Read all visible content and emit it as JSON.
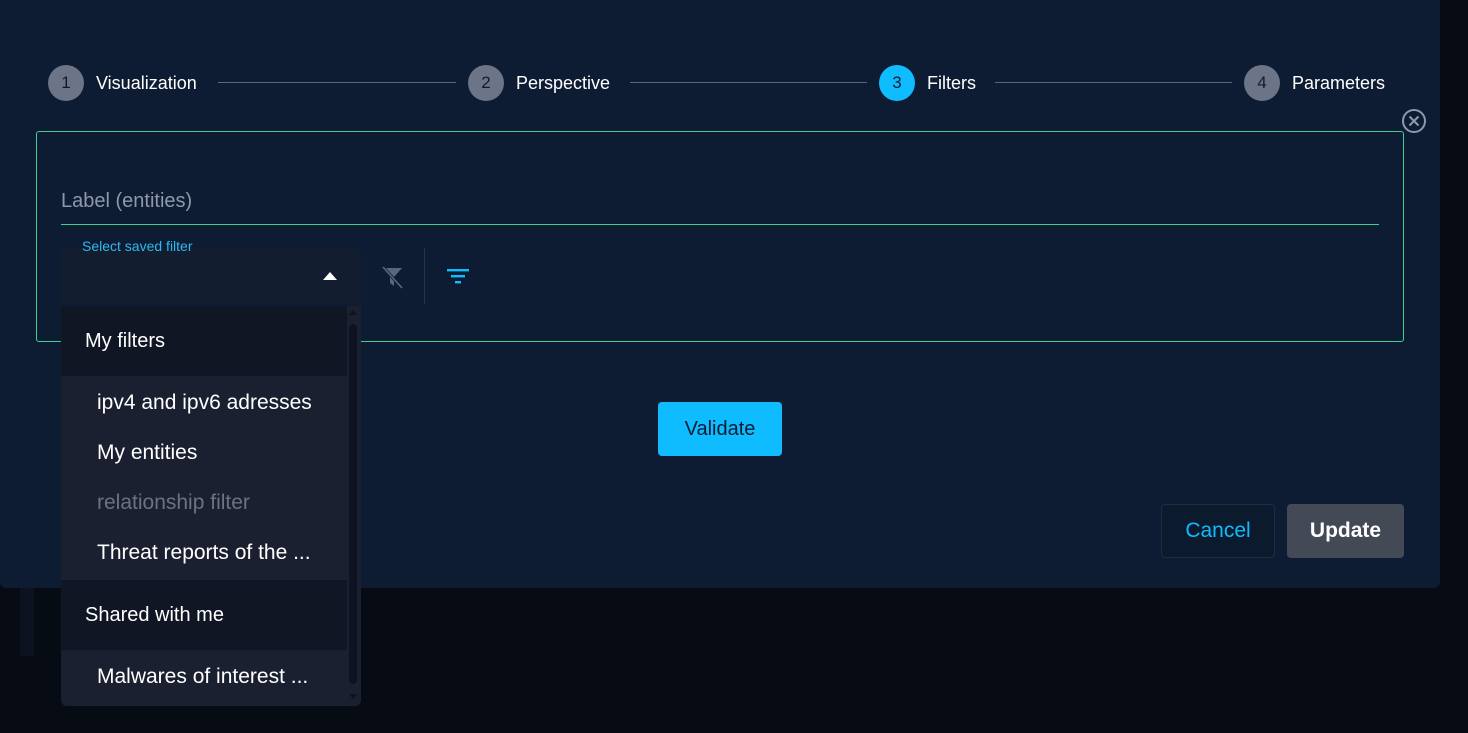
{
  "stepper": {
    "steps": [
      {
        "number": "1",
        "label": "Visualization",
        "active": false
      },
      {
        "number": "2",
        "label": "Perspective",
        "active": false
      },
      {
        "number": "3",
        "label": "Filters",
        "active": true
      },
      {
        "number": "4",
        "label": "Parameters",
        "active": false
      }
    ]
  },
  "filters": {
    "label_placeholder": "Label (entities)",
    "saved_filter_caption": "Select saved filter",
    "saved_filter_value": ""
  },
  "dropdown": {
    "groups": [
      {
        "header": "My filters",
        "options": [
          {
            "label": "ipv4 and ipv6 adresses",
            "disabled": false
          },
          {
            "label": "My entities",
            "disabled": false
          },
          {
            "label": "relationship filter",
            "disabled": true
          },
          {
            "label": "Threat reports of the ...",
            "disabled": false
          }
        ]
      },
      {
        "header": "Shared with me",
        "options": [
          {
            "label": "Malwares of interest ...",
            "disabled": false
          }
        ]
      }
    ]
  },
  "buttons": {
    "validate": "Validate",
    "cancel": "Cancel",
    "update": "Update"
  },
  "icons": {
    "close": "close-circle-icon",
    "clear_filter": "filter-off-icon",
    "filter": "filter-list-icon",
    "caret": "caret-up-icon"
  },
  "colors": {
    "accent": "#0fbcff",
    "border_success": "#3fcf8e",
    "dialog_bg": "#0e1c33"
  }
}
